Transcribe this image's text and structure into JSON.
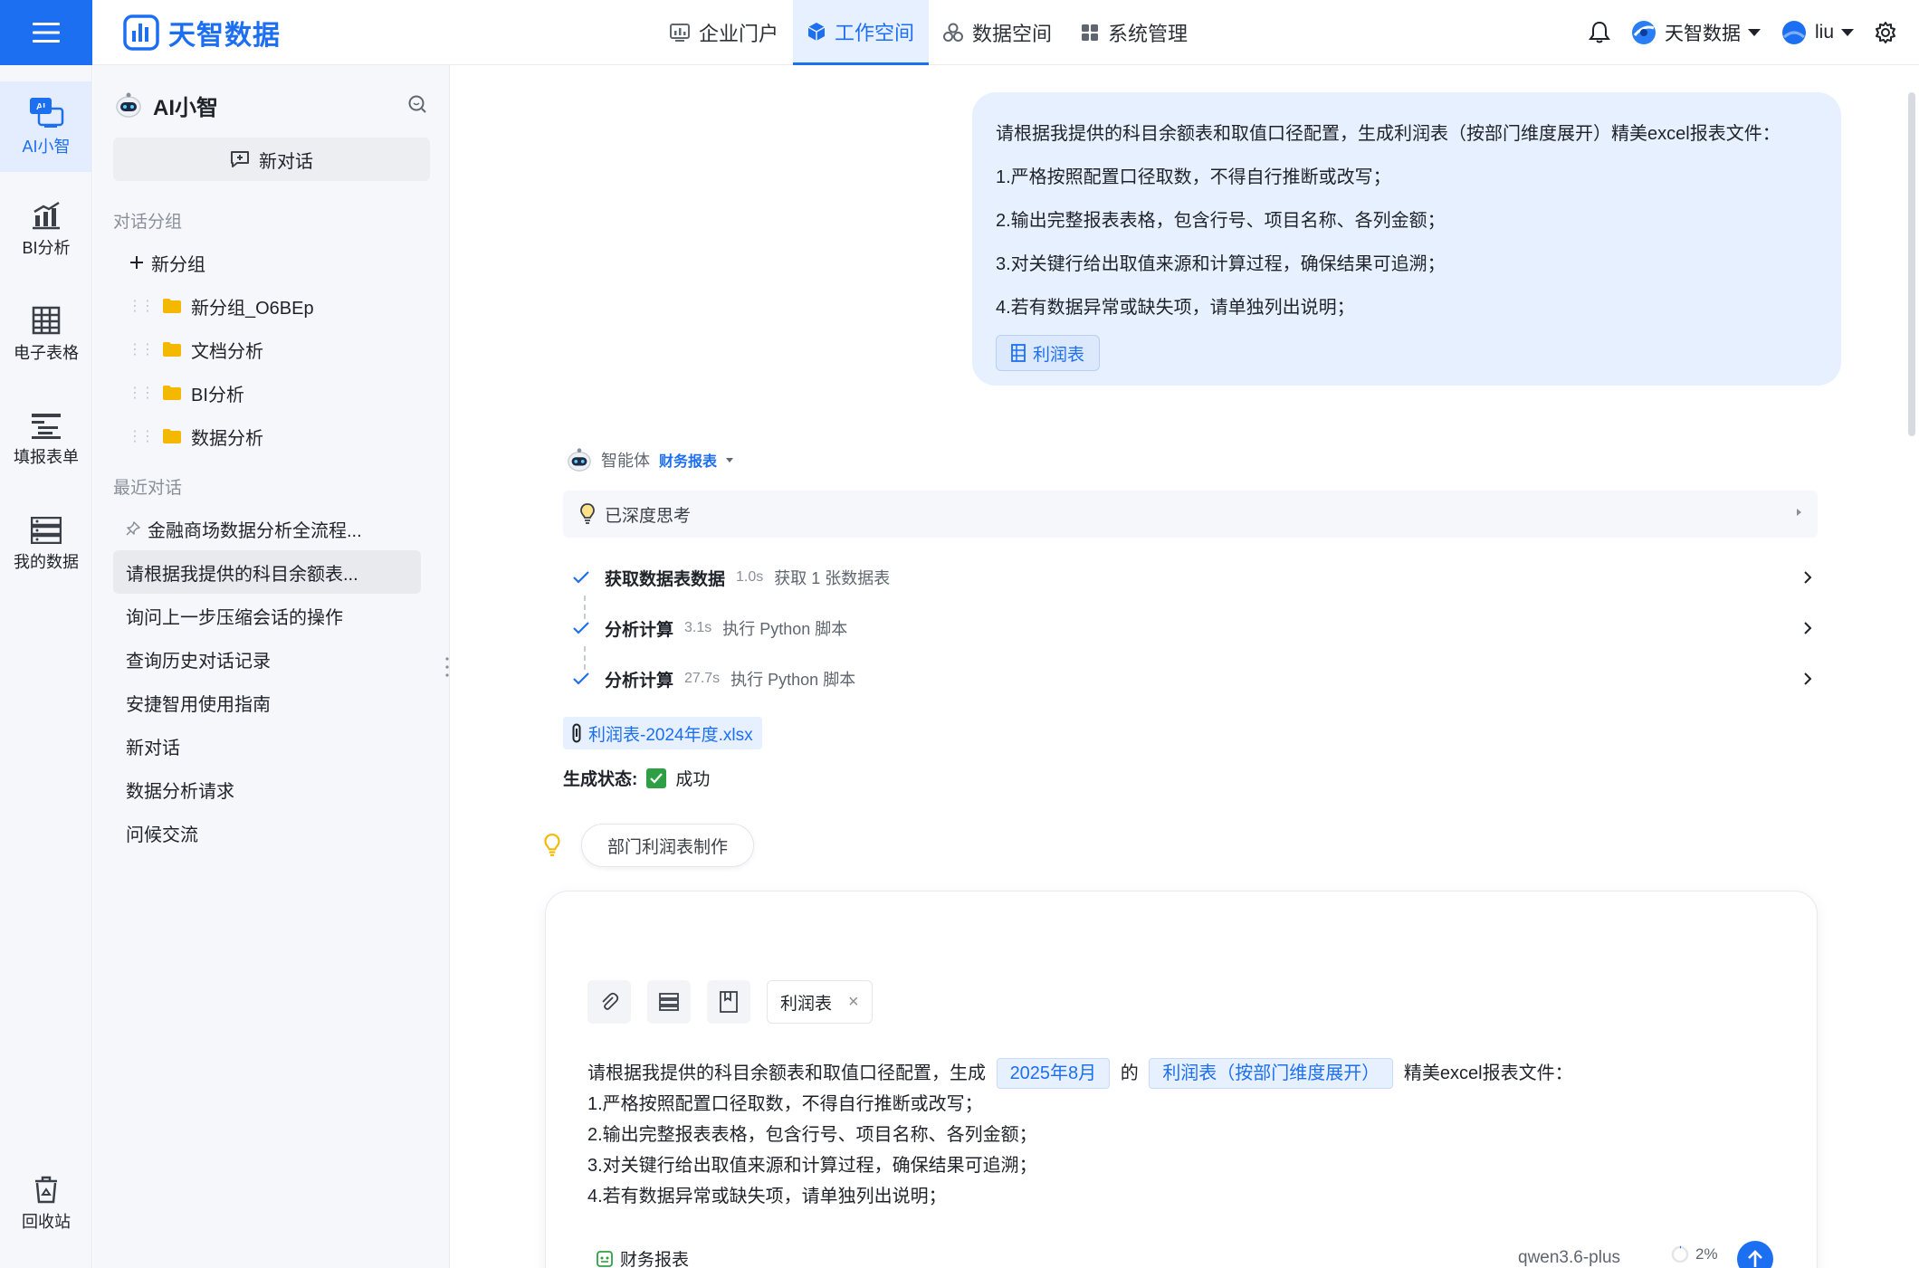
{
  "topbar": {
    "brand_name": "天智数据",
    "nav": [
      {
        "label": "企业门户",
        "icon": "chart-icon",
        "active": false
      },
      {
        "label": "工作空间",
        "icon": "cube-icon",
        "active": true
      },
      {
        "label": "数据空间",
        "icon": "cluster-icon",
        "active": false
      },
      {
        "label": "系统管理",
        "icon": "grid-icon",
        "active": false
      }
    ],
    "org_name": "天智数据",
    "user_name": "liu"
  },
  "rail": {
    "items": [
      {
        "label": "AI小智",
        "icon": "ai-assistant-icon",
        "active": true
      },
      {
        "label": "BI分析",
        "icon": "bar-chart-icon",
        "active": false
      },
      {
        "label": "电子表格",
        "icon": "spreadsheet-icon",
        "active": false
      },
      {
        "label": "填报表单",
        "icon": "form-icon",
        "active": false
      },
      {
        "label": "我的数据",
        "icon": "database-icon",
        "active": false
      }
    ],
    "recycle_label": "回收站"
  },
  "sidebar": {
    "title": "AI小智",
    "new_chat_label": "新对话",
    "groups_section": "对话分组",
    "new_group_label": "新分组",
    "groups": [
      {
        "label": "新分组_O6BEp"
      },
      {
        "label": "文档分析"
      },
      {
        "label": "BI分析"
      },
      {
        "label": "数据分析"
      }
    ],
    "recent_section": "最近对话",
    "recent": [
      {
        "label": "金融商场数据分析全流程...",
        "pinned": true,
        "selected": false
      },
      {
        "label": "请根据我提供的科目余额表...",
        "pinned": false,
        "selected": true
      },
      {
        "label": "询问上一步压缩会话的操作",
        "pinned": false,
        "selected": false
      },
      {
        "label": "查询历史对话记录",
        "pinned": false,
        "selected": false
      },
      {
        "label": "安捷智用使用指南",
        "pinned": false,
        "selected": false
      },
      {
        "label": "新对话",
        "pinned": false,
        "selected": false
      },
      {
        "label": "数据分析请求",
        "pinned": false,
        "selected": false
      },
      {
        "label": "问候交流",
        "pinned": false,
        "selected": false
      }
    ]
  },
  "conversation": {
    "user_message": {
      "lines": [
        "请根据我提供的科目余额表和取值口径配置，生成利润表（按部门维度展开）精美excel报表文件：",
        "1.严格按照配置口径取数，不得自行推断或改写；",
        "2.输出完整报表表格，包含行号、项目名称、各列金额；",
        "3.对关键行给出取值来源和计算过程，确保结果可追溯；",
        "4.若有数据异常或缺失项，请单独列出说明；"
      ],
      "attachment": "利润表"
    },
    "agent_label": "智能体",
    "agent_name": "财务报表",
    "thinking_label": "已深度思考",
    "steps": [
      {
        "title": "获取数据表数据",
        "time": "1.0s",
        "desc": "获取 1 张数据表"
      },
      {
        "title": "分析计算",
        "time": "3.1s",
        "desc": "执行 Python 脚本"
      },
      {
        "title": "分析计算",
        "time": "27.7s",
        "desc": "执行 Python 脚本"
      }
    ],
    "file_name": "利润表-2024年度.xlsx",
    "status_label": "生成状态:",
    "status_value": "成功",
    "suggestion": "部门利润表制作"
  },
  "composer": {
    "context_tag": "利润表",
    "prompt_pre": "请根据我提供的科目余额表和取值口径配置，生成",
    "slot_period": "2025年8月",
    "prompt_mid": "的",
    "slot_report": "利润表（按部门维度展开）",
    "prompt_post": "精美excel报表文件：",
    "prompt_lines": [
      "1.严格按照配置口径取数，不得自行推断或改写；",
      "2.输出完整报表表格，包含行号、项目名称、各列金额；",
      "3.对关键行给出取值来源和计算过程，确保结果可追溯；",
      "4.若有数据异常或缺失项，请单独列出说明；"
    ],
    "agent_name": "财务报表",
    "model": "qwen3.6-plus",
    "context_usage": "2%"
  },
  "colors": {
    "accent": "#1d6ff2",
    "accent_light": "#e7f0fe",
    "success": "#2ea043",
    "folder": "#f5b800"
  }
}
